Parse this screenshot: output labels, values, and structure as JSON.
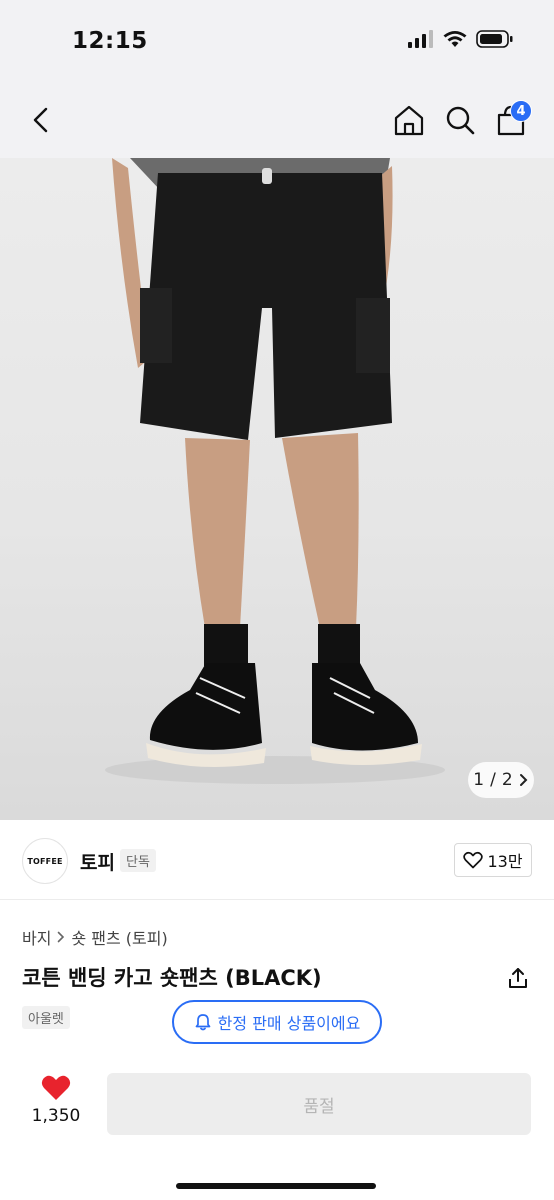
{
  "status": {
    "time": "12:15",
    "icons": [
      "signal-icon",
      "wifi-icon",
      "battery-icon"
    ]
  },
  "nav": {
    "icons": [
      "back-icon",
      "home-icon",
      "search-icon",
      "cart-icon"
    ],
    "cart_count": "4"
  },
  "gallery": {
    "current": "1",
    "separator": "/",
    "total": "2"
  },
  "brand": {
    "logo_text": "TOFFEE",
    "name": "토피",
    "tag": "단독",
    "likes": "13만"
  },
  "product": {
    "breadcrumb": [
      "바지",
      "숏 팬츠 (토피)"
    ],
    "title": "코튼 밴딩 카고 숏팬츠 (BLACK)",
    "tag": "아울렛",
    "limited_label": "한정 판매 상품이에요"
  },
  "bottom": {
    "wish_count": "1,350",
    "buy_label": "품절"
  },
  "colors": {
    "accent": "#2a6df5",
    "heart": "#e8232d",
    "disabled_bg": "#ededed"
  }
}
